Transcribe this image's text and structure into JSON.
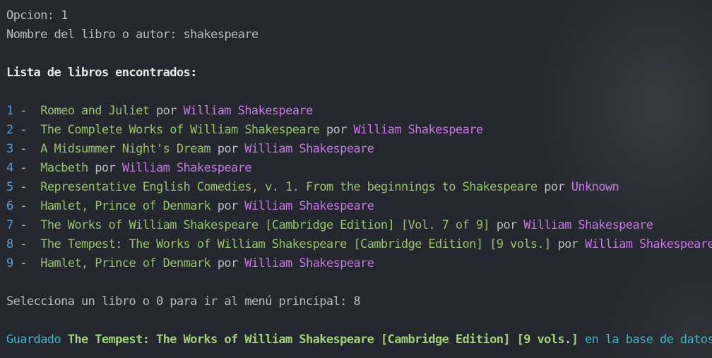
{
  "prompt": {
    "opcion_label": "Opcion: ",
    "opcion_value": "1",
    "search_label": "Nombre del libro o autor: ",
    "search_value": "shakespeare"
  },
  "list_heading": "Lista de libros encontrados:",
  "separator": " -  ",
  "por_word": " por ",
  "books": [
    {
      "num": "1",
      "title": "Romeo and Juliet",
      "author": "William Shakespeare"
    },
    {
      "num": "2",
      "title": "The Complete Works of William Shakespeare",
      "author": "William Shakespeare"
    },
    {
      "num": "3",
      "title": "A Midsummer Night's Dream",
      "author": "William Shakespeare"
    },
    {
      "num": "4",
      "title": "Macbeth",
      "author": "William Shakespeare"
    },
    {
      "num": "5",
      "title": "Representative English Comedies, v. 1. From the beginnings to Shakespeare",
      "author": "Unknown"
    },
    {
      "num": "6",
      "title": "Hamlet, Prince of Denmark",
      "author": "William Shakespeare"
    },
    {
      "num": "7",
      "title": "The Works of William Shakespeare [Cambridge Edition] [Vol. 7 of 9]",
      "author": "William Shakespeare"
    },
    {
      "num": "8",
      "title": "The Tempest: The Works of William Shakespeare [Cambridge Edition] [9 vols.]",
      "author": "William Shakespeare"
    },
    {
      "num": "9",
      "title": "Hamlet, Prince of Denmark",
      "author": "William Shakespeare"
    }
  ],
  "select_prompt": {
    "label": "Selecciona un libro o 0 para ir al menú principal: ",
    "value": "8"
  },
  "saved_message": {
    "prefix": "Guardado ",
    "title": "The Tempest: The Works of William Shakespeare [Cambridge Edition] [9 vols.]",
    "suffix": " en la base de datos. :)"
  },
  "colors": {
    "background": "#24272e",
    "number": "#5e9bd6",
    "title": "#97c26b",
    "author": "#c478e0",
    "saved_prefix": "#3fb4c9"
  }
}
